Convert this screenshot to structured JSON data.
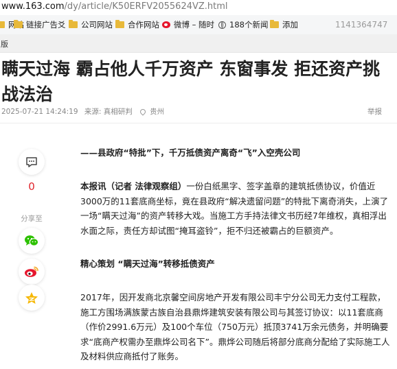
{
  "browser": {
    "url_host": "www.163.com",
    "url_path": "/dy/article/K50ERFV2055624VZ.html"
  },
  "bookmarks": {
    "items": [
      {
        "label": "网站",
        "icon": "folder-icon"
      },
      {
        "label": "链接广告爻",
        "icon": "folder-icon"
      },
      {
        "label": "公司网站",
        "icon": "folder-icon"
      },
      {
        "label": "合作网站",
        "icon": "folder-icon"
      },
      {
        "label": "微博 – 随时",
        "icon": "weibo-icon"
      },
      {
        "label": "188个新闻",
        "icon": "globe-icon"
      },
      {
        "label": "添加",
        "icon": "folder-icon"
      }
    ],
    "qq": "1141364747"
  },
  "top_strip": {
    "label": "版"
  },
  "article": {
    "title": "瞒天过海 霸占他人千万资产 东窗事发 拒还资产挑战法治",
    "date": "2025-07-21 14:24:19",
    "source": "来源: 真相研判",
    "location": "贵州",
    "report": "举报",
    "sections": [
      {
        "heading": "——县政府“特批”下，千万抵债资产离奇“飞”入空壳公司"
      },
      {
        "lead": "本报讯（记者 法律观察组）",
        "text": "一份白纸黑字、签字盖章的建筑抵债协议，价值近3000万的11套底商坐标，竟在县政府“解决遗留问题”的特批下离奇消失，上演了一场“瞒天过海”的资产转移大戏。当施工方手持法律文书历经7年维权，真相浮出水面之际，责任方却试图“掩耳盗铃”，拒不归还被霸占的巨额资产。"
      },
      {
        "heading": "精心策划 “瞒天过海”转移抵债资产"
      },
      {
        "text": "2017年，因开发商北京馨空间房地产开发有限公司丰宁分公司无力支付工程款，施工方围场满族蒙古族自治县鼎烨建筑安装有限公司与其签订协议：以11套底商（作价2991.6万元）及100个车位（750万元）抵顶3741万余元债务，并明确要求“底商产权需办至鼎烨公司名下”。鼎烨公司随后将部分底商分配给了实际施工人及材料供应商抵付了账务。"
      }
    ]
  },
  "sidebar": {
    "comment_count": "0",
    "share_label": "分享至",
    "share_icons": [
      "wechat-icon",
      "weibo-icon",
      "qzone-icon"
    ]
  },
  "colors": {
    "accent": "#e0242b",
    "wechat": "#2dc100",
    "weibo": "#e6162d",
    "qzone": "#f6b700"
  }
}
